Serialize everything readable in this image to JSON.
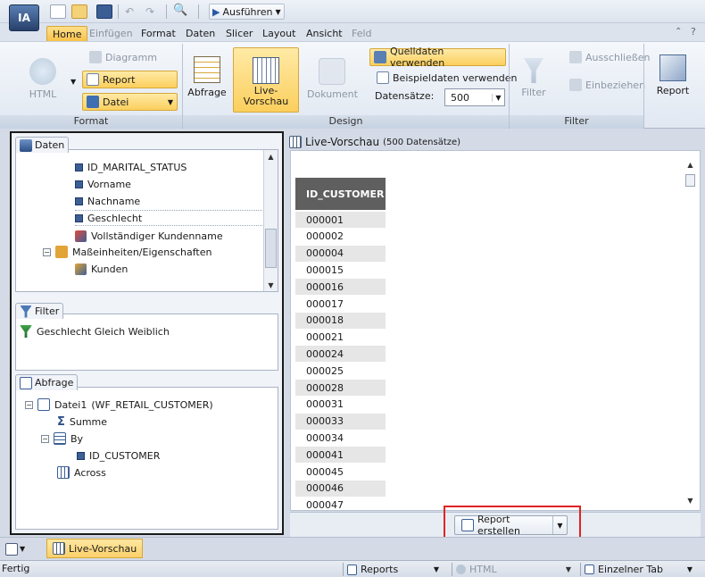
{
  "app": {
    "logo": "IA"
  },
  "toolbar": {
    "run_label": "Ausführen"
  },
  "menu_tabs": [
    "Home",
    "Einfügen",
    "Format",
    "Daten",
    "Slicer",
    "Layout",
    "Ansicht",
    "Feld"
  ],
  "ribbon": {
    "format": {
      "html_label": "HTML",
      "diagramm_label": "Diagramm",
      "report_label": "Report",
      "datei_label": "Datei",
      "caption": "Format"
    },
    "design": {
      "abfrage_label": "Abfrage",
      "live_vorschau_line1": "Live-",
      "live_vorschau_line2": "Vorschau",
      "dokument_label": "Dokument",
      "quelldaten_label": "Quelldaten verwenden",
      "beispieldaten_label": "Beispieldaten verwenden",
      "datensaetze_label": "Datensätze:",
      "datensaetze_value": "500",
      "caption": "Design"
    },
    "filter": {
      "filter_label": "Filter",
      "ausschliessen_label": "Ausschließen",
      "einbeziehen_label": "Einbeziehen",
      "caption": "Filter"
    },
    "report": {
      "report_label": "Report"
    }
  },
  "daten_panel": {
    "title": "Daten",
    "items": [
      "ID_MARITAL_STATUS",
      "Vorname",
      "Nachname",
      "Geschlecht",
      "Vollständiger Kundenname",
      "Maßeinheiten/Eigenschaften",
      "Kunden"
    ]
  },
  "filter_panel": {
    "title": "Filter",
    "condition": "Geschlecht Gleich Weiblich"
  },
  "abfrage_panel": {
    "title": "Abfrage",
    "datei": "Datei1",
    "datei_source": "(WF_RETAIL_CUSTOMER)",
    "summe": "Summe",
    "by": "By",
    "by_field": "ID_CUSTOMER",
    "across": "Across"
  },
  "preview": {
    "title": "Live-Vorschau",
    "subtitle": "(500 Datensätze)",
    "column_header": "ID_CUSTOMER",
    "rows": [
      "000001",
      "000002",
      "000004",
      "000015",
      "000016",
      "000017",
      "000018",
      "000021",
      "000024",
      "000025",
      "000028",
      "000031",
      "000033",
      "000034",
      "000041",
      "000045",
      "000046",
      "000047"
    ],
    "report_button": "Report erstellen"
  },
  "bottom_tab": {
    "label": "Live-Vorschau"
  },
  "status": {
    "text": "Fertig",
    "reports": "Reports",
    "html": "HTML",
    "einzelner_tab": "Einzelner Tab"
  },
  "colors": {
    "accent": "#f7c24a",
    "highlight_frame": "#e02424",
    "header_bg": "#5f5f5f"
  }
}
